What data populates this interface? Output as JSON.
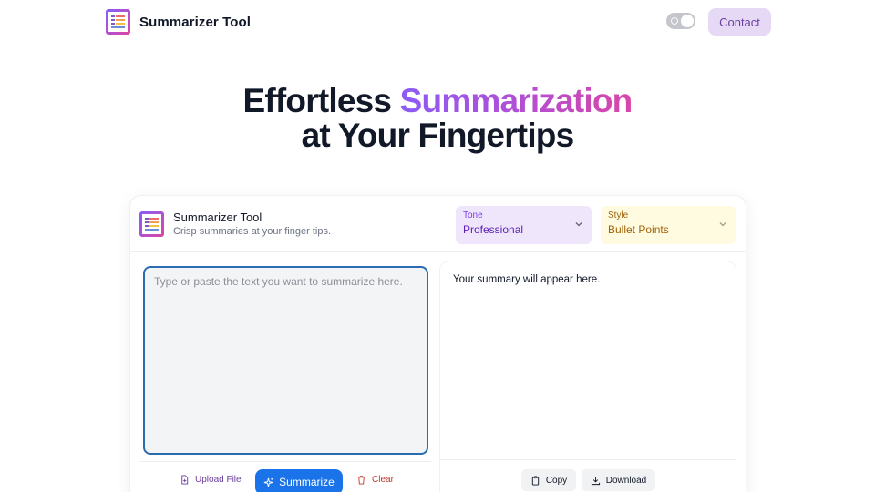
{
  "header": {
    "brand_name": "Summarizer Tool",
    "contact_label": "Contact",
    "theme_toggle": {
      "state": "on"
    }
  },
  "hero": {
    "line1_plain": "Effortless ",
    "line1_accent": "Summarization",
    "line2": "at Your Fingertips"
  },
  "tool": {
    "title": "Summarizer Tool",
    "subtitle": "Crisp summaries at your finger tips.",
    "tone": {
      "label": "Tone",
      "value": "Professional"
    },
    "style": {
      "label": "Style",
      "value": "Bullet Points"
    },
    "input": {
      "placeholder": "Type or paste the text you want to summarize here.",
      "value": ""
    },
    "upload_label": "Upload File",
    "summarize_label": "Summarize",
    "clear_label": "Clear",
    "output_placeholder": "Your summary will appear here.",
    "copy_label": "Copy",
    "download_label": "Download"
  },
  "colors": {
    "accent_gradient_start": "#8b5cf6",
    "accent_gradient_end": "#d946a8",
    "primary_button": "#1a73e8",
    "contact_bg": "#e6d9f6",
    "tone_bg": "#efe6fb",
    "style_bg": "#fefbe0"
  },
  "icons": {
    "logo": "summarizer-logo-icon",
    "chevron": "chevron-down-icon",
    "upload": "file-icon",
    "summarize": "sparkles-icon",
    "clear": "trash-icon",
    "copy": "clipboard-icon",
    "download": "download-icon"
  }
}
